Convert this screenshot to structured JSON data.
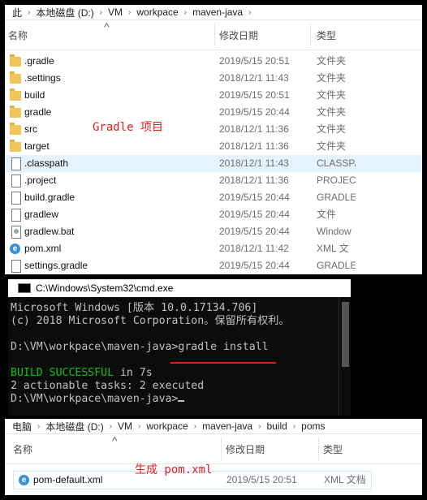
{
  "explorer1": {
    "breadcrumb": [
      "此",
      "本地磁盘 (D:)",
      "VM",
      "workpace",
      "maven-java"
    ],
    "columns": {
      "name": "名称",
      "date": "修改日期",
      "type": "类型"
    },
    "files": [
      {
        "name": ".gradle",
        "date": "2019/5/15 20:51",
        "type": "文件夹",
        "icon": "folder-icon"
      },
      {
        "name": ".settings",
        "date": "2018/12/1 11:43",
        "type": "文件夹",
        "icon": "folder-icon"
      },
      {
        "name": "build",
        "date": "2019/5/15 20:51",
        "type": "文件夹",
        "icon": "folder-icon"
      },
      {
        "name": "gradle",
        "date": "2019/5/15 20:44",
        "type": "文件夹",
        "icon": "folder-icon"
      },
      {
        "name": "src",
        "date": "2018/12/1 11:36",
        "type": "文件夹",
        "icon": "folder-icon"
      },
      {
        "name": "target",
        "date": "2018/12/1 11:36",
        "type": "文件夹",
        "icon": "folder-icon"
      },
      {
        "name": ".classpath",
        "date": "2018/12/1 11:43",
        "type": "CLASSPA",
        "icon": "file-icon",
        "selected": true
      },
      {
        "name": ".project",
        "date": "2018/12/1 11:36",
        "type": "PROJECT",
        "icon": "file-icon"
      },
      {
        "name": "build.gradle",
        "date": "2019/5/15 20:44",
        "type": "GRADLE",
        "icon": "file-icon"
      },
      {
        "name": "gradlew",
        "date": "2019/5/15 20:44",
        "type": "文件",
        "icon": "file-icon"
      },
      {
        "name": "gradlew.bat",
        "date": "2019/5/15 20:44",
        "type": "Window",
        "icon": "gradlew-icon"
      },
      {
        "name": "pom.xml",
        "date": "2018/12/1 11:42",
        "type": "XML 文",
        "icon": "xml-icon"
      },
      {
        "name": "settings.gradle",
        "date": "2019/5/15 20:44",
        "type": "GRADLE",
        "icon": "file-icon"
      }
    ],
    "annotation": "Gradle 项目"
  },
  "cmd": {
    "title": "C:\\Windows\\System32\\cmd.exe",
    "lines": {
      "l1": "Microsoft Windows [版本 10.0.17134.706]",
      "l2": "(c) 2018 Microsoft Corporation。保留所有权利。",
      "l3": "D:\\VM\\workpace\\maven-java>gradle install",
      "l4a": "BUILD SUCCESSFUL",
      "l4b": " in 7s",
      "l5": "2 actionable tasks: 2 executed",
      "l6": "D:\\VM\\workpace\\maven-java>"
    }
  },
  "explorer2": {
    "breadcrumb": [
      "电脑",
      "本地磁盘 (D:)",
      "VM",
      "workpace",
      "maven-java",
      "build",
      "poms"
    ],
    "columns": {
      "name": "名称",
      "date": "修改日期",
      "type": "类型"
    },
    "files": [
      {
        "name": "pom-default.xml",
        "date": "2019/5/15 20:51",
        "type": "XML 文档",
        "icon": "xml-icon"
      }
    ],
    "annotation": "生成 pom.xml"
  },
  "colors": {
    "accent_red": "#e02020",
    "console_green": "#13c113",
    "selection": "#e5f3ff"
  }
}
